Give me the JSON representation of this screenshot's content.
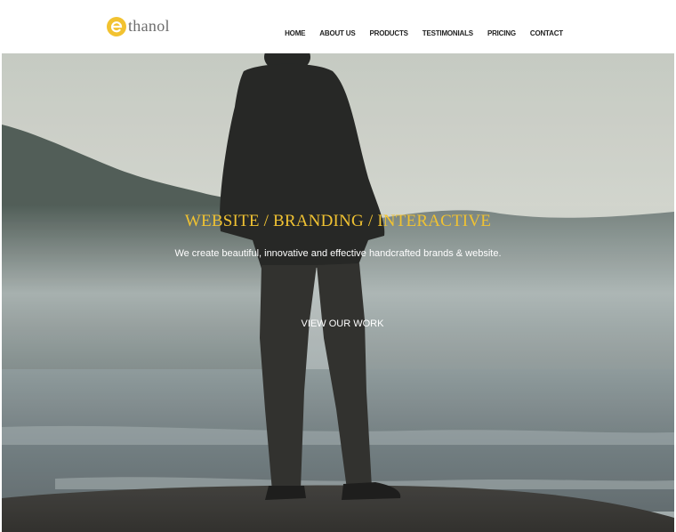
{
  "header": {
    "logo": {
      "text": "thanol",
      "mark_letter": "e",
      "mark_color": "#f2c230"
    },
    "nav": [
      "HOME",
      "ABOUT US",
      "PRODUCTS",
      "TESTIMONIALS",
      "PRICING",
      "CONTACT"
    ]
  },
  "hero": {
    "headline": "WEBSITE / BRANDING / INTERACTIVE",
    "tagline": "We create beautiful, innovative and effective handcrafted brands & website.",
    "cta_label": "VIEW OUR WORK",
    "accent_color": "#f0c232"
  }
}
